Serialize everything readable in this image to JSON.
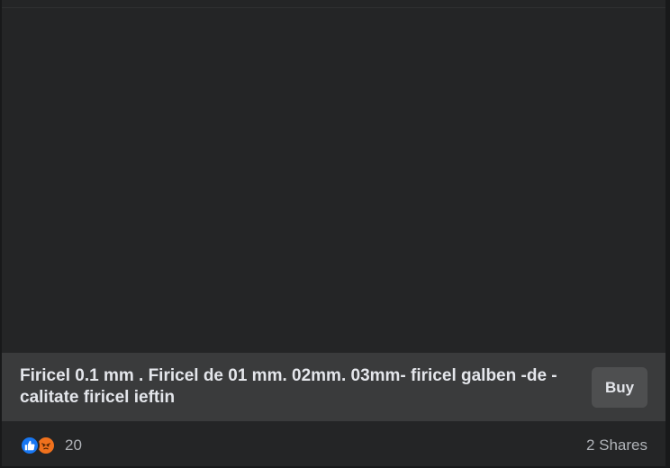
{
  "product": {
    "title": "Firicel 0.1 mm . Firicel de 01 mm. 02mm. 03mm- firicel galben -de -calitate firicel ieftin",
    "buy_label": "Buy"
  },
  "engagement": {
    "reaction_count": "20",
    "shares_label": "2 Shares",
    "reactions": [
      "like-icon",
      "angry-icon"
    ]
  },
  "colors": {
    "card_bg": "#242526",
    "product_bar_bg": "#3a3b3c",
    "button_bg": "#4e4f50",
    "like_blue": "#1877f2",
    "angry_orange": "#f0711d"
  }
}
